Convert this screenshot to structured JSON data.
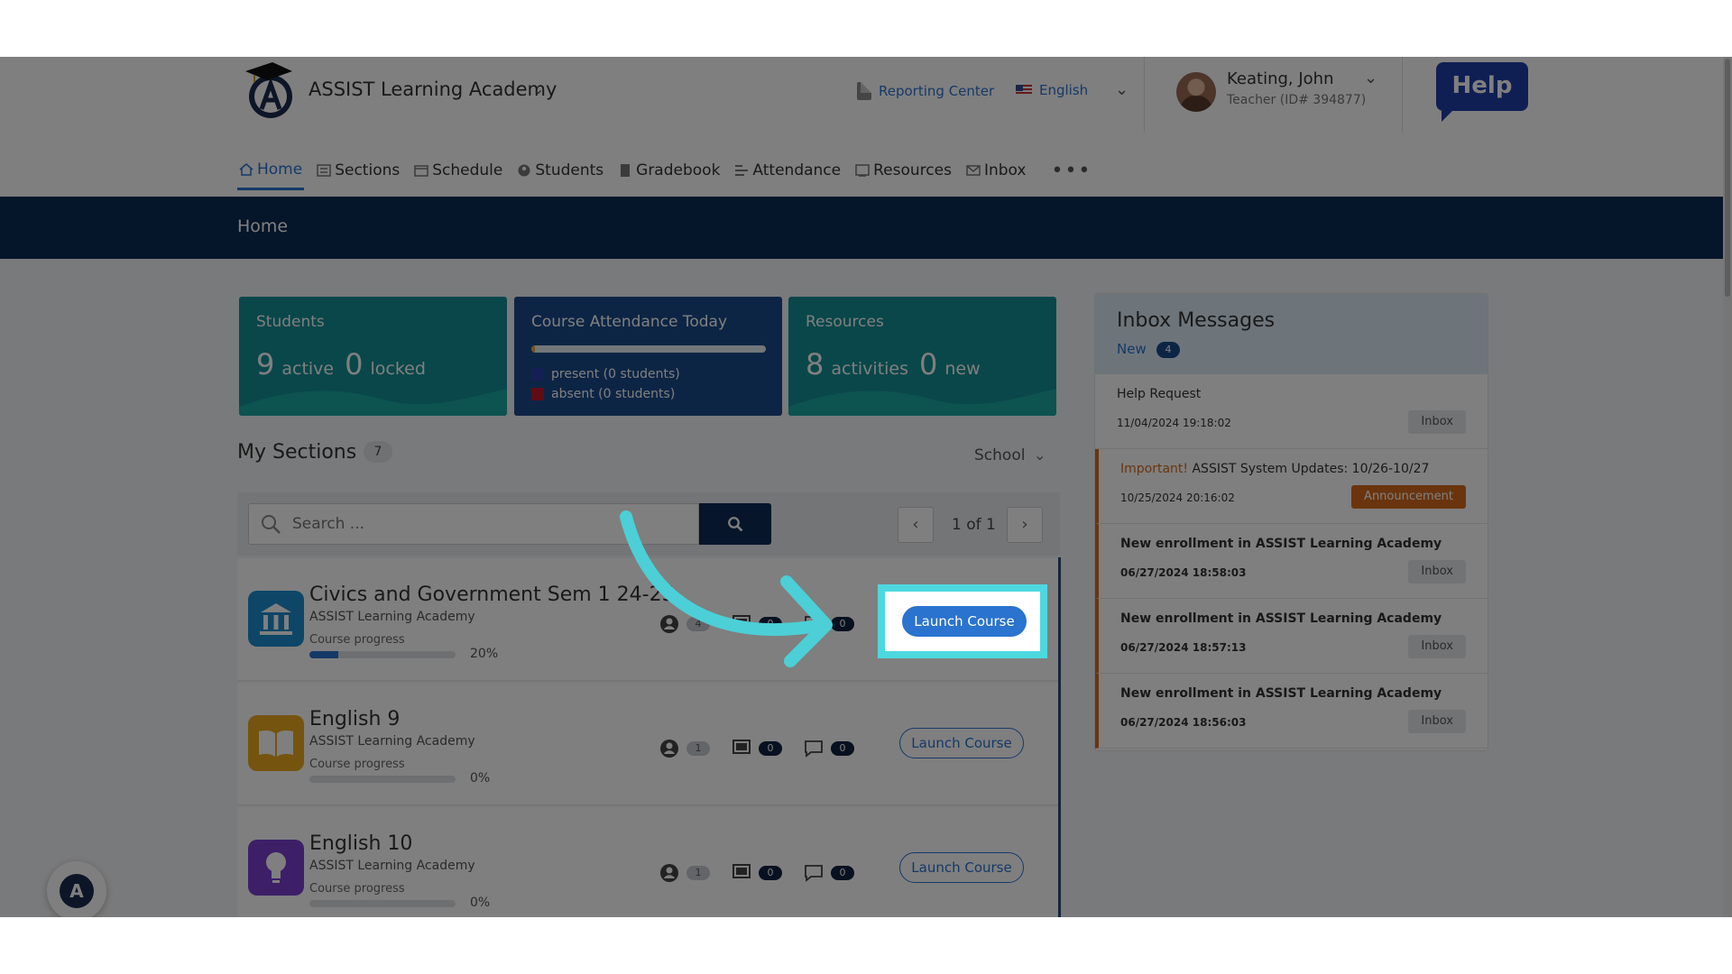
{
  "header": {
    "brand": "ASSIST Learning Academy",
    "reporting_center": "Reporting Center",
    "language": "English",
    "user_name": "Keating, John",
    "user_role": "Teacher (ID# 394877)",
    "help": "Help"
  },
  "nav": {
    "items": [
      {
        "label": "Home",
        "icon": "home-icon"
      },
      {
        "label": "Sections",
        "icon": "sections-icon"
      },
      {
        "label": "Schedule",
        "icon": "calendar-icon"
      },
      {
        "label": "Students",
        "icon": "user-icon"
      },
      {
        "label": "Gradebook",
        "icon": "book-icon"
      },
      {
        "label": "Attendance",
        "icon": "attendance-icon"
      },
      {
        "label": "Resources",
        "icon": "resources-icon"
      },
      {
        "label": "Inbox",
        "icon": "mail-icon"
      }
    ],
    "more": "•••"
  },
  "page_title": "Home",
  "cards": {
    "students": {
      "title": "Students",
      "active_count": "9",
      "active_label": "active",
      "locked_count": "0",
      "locked_label": "locked"
    },
    "attendance": {
      "title": "Course Attendance Today",
      "present": "present (0 students)",
      "absent": "absent (0 students)",
      "present_color": "#2c3fa6",
      "absent_color": "#c0182a"
    },
    "resources": {
      "title": "Resources",
      "activities_count": "8",
      "activities_label": "activities",
      "new_count": "0",
      "new_label": "new"
    }
  },
  "sections": {
    "title": "My Sections",
    "count": "7",
    "filter": "School",
    "search_placeholder": "Search ...",
    "pagination": "1 of 1",
    "rows": [
      {
        "title": "Civics and Government Sem 1 24-25",
        "org": "ASSIST Learning Academy",
        "progress_label": "Course progress",
        "progress": "20%",
        "progress_value": 0.2,
        "students": "4",
        "resources": "0",
        "messages": "0",
        "launch": "Launch Course",
        "icon": "government-building-icon",
        "icon_color": "#1c8dd1"
      },
      {
        "title": "English 9",
        "org": "ASSIST Learning Academy",
        "progress_label": "Course progress",
        "progress": "0%",
        "progress_value": 0,
        "students": "1",
        "resources": "0",
        "messages": "0",
        "launch": "Launch Course",
        "icon": "open-book-icon",
        "icon_color": "#e9a81f"
      },
      {
        "title": "English 10",
        "org": "ASSIST Learning Academy",
        "progress_label": "Course progress",
        "progress": "0%",
        "progress_value": 0,
        "students": "1",
        "resources": "0",
        "messages": "0",
        "launch": "Launch Course",
        "icon": "lightbulb-icon",
        "icon_color": "#7a3fd0"
      }
    ]
  },
  "inbox": {
    "title": "Inbox Messages",
    "new_label": "New",
    "new_count": "4",
    "messages": [
      {
        "prefix": "",
        "title": "Help Request",
        "date": "11/04/2024 19:18:02",
        "tag": "Inbox"
      },
      {
        "prefix": "Important!",
        "title": "ASSIST System Updates: 10/26-10/27",
        "date": "10/25/2024 20:16:02",
        "tag": "Announcement"
      },
      {
        "prefix": "",
        "title": "New enrollment in ASSIST Learning Academy",
        "date": "06/27/2024 18:58:03",
        "tag": "Inbox"
      },
      {
        "prefix": "",
        "title": "New enrollment in ASSIST Learning Academy",
        "date": "06/27/2024 18:57:13",
        "tag": "Inbox"
      },
      {
        "prefix": "",
        "title": "New enrollment in ASSIST Learning Academy",
        "date": "06/27/2024 18:56:03",
        "tag": "Inbox"
      }
    ]
  },
  "widget": {
    "label": "A"
  },
  "colors": {
    "accent": "#2a73cf",
    "navy": "#0b2b55",
    "teal": "#138e94",
    "highlight": "#4dd8e0",
    "orange": "#d46a1d"
  }
}
